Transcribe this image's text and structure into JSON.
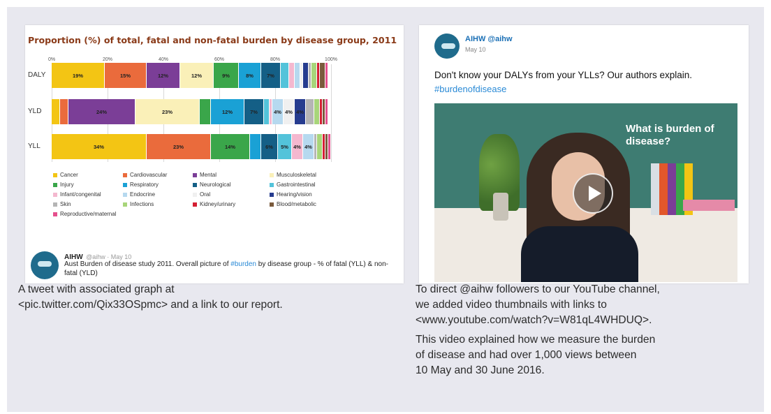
{
  "left": {
    "chart_data": {
      "type": "bar",
      "title": "Proportion (%) of total, fatal and non-fatal burden by disease group, 2011",
      "x_ticks": [
        "0%",
        "20%",
        "40%",
        "60%",
        "80%",
        "100%"
      ],
      "xlim": [
        0,
        100
      ],
      "grid": true,
      "legend_position": "bottom",
      "categories": [
        "DALY",
        "YLD",
        "YLL"
      ],
      "series": [
        {
          "name": "Cancer",
          "color": "#f3c514",
          "values": [
            19,
            3,
            34
          ],
          "labels": [
            "19%",
            "",
            "34%"
          ]
        },
        {
          "name": "Cardiovascular",
          "color": "#ea6b3c",
          "values": [
            15,
            3,
            23
          ],
          "labels": [
            "15%",
            "",
            "23%"
          ]
        },
        {
          "name": "Mental",
          "color": "#7b3e97",
          "values": [
            12,
            24,
            0
          ],
          "labels": [
            "12%",
            "24%",
            ""
          ]
        },
        {
          "name": "Musculoskeletal",
          "color": "#faf0b8",
          "values": [
            12,
            23,
            0
          ],
          "labels": [
            "12%",
            "23%",
            ""
          ]
        },
        {
          "name": "Injury",
          "color": "#3aa64a",
          "values": [
            9,
            4,
            14
          ],
          "labels": [
            "9%",
            "",
            "14%"
          ]
        },
        {
          "name": "Respiratory",
          "color": "#1aa1d5",
          "values": [
            8,
            12,
            4
          ],
          "labels": [
            "8%",
            "12%",
            ""
          ]
        },
        {
          "name": "Neurological",
          "color": "#145f86",
          "values": [
            7,
            7,
            6
          ],
          "labels": [
            "7%",
            "7%",
            "6%"
          ]
        },
        {
          "name": "Gastrointestinal",
          "color": "#53c3da",
          "values": [
            3,
            2,
            5
          ],
          "labels": [
            "",
            "",
            "5%"
          ]
        },
        {
          "name": "Infant/congenital",
          "color": "#f4b8cf",
          "values": [
            2,
            1,
            4
          ],
          "labels": [
            "",
            "",
            "4%"
          ]
        },
        {
          "name": "Endocrine",
          "color": "#b6d9ef",
          "values": [
            2,
            4,
            4
          ],
          "labels": [
            "",
            "4%",
            "4%"
          ]
        },
        {
          "name": "Oral",
          "color": "#f0f0f0",
          "values": [
            1,
            4,
            0
          ],
          "labels": [
            "",
            "4%",
            ""
          ]
        },
        {
          "name": "Hearing/vision",
          "color": "#263c8f",
          "values": [
            2,
            4,
            0
          ],
          "labels": [
            "",
            "4%",
            ""
          ]
        },
        {
          "name": "Skin",
          "color": "#b5b5b5",
          "values": [
            1,
            3,
            1
          ],
          "labels": [
            "",
            "",
            ""
          ]
        },
        {
          "name": "Infections",
          "color": "#a8d57a",
          "values": [
            2,
            2,
            2
          ],
          "labels": [
            "",
            "",
            ""
          ]
        },
        {
          "name": "Kidney/urinary",
          "color": "#d41f33",
          "values": [
            1,
            1,
            1
          ],
          "labels": [
            "",
            "",
            ""
          ]
        },
        {
          "name": "Blood/metabolic",
          "color": "#7a5a3c",
          "values": [
            2,
            1,
            1
          ],
          "labels": [
            "",
            "",
            ""
          ]
        },
        {
          "name": "Reproductive/maternal",
          "color": "#e5508d",
          "values": [
            1,
            1,
            1
          ],
          "labels": [
            "",
            "",
            ""
          ]
        }
      ]
    },
    "tweet": {
      "name": "AIHW",
      "meta": "@aihw · May 10",
      "text_before": "Aust Burden of disease study 2011. Overall picture of ",
      "hashtag": "#burden",
      "text_after": " by disease group - % of fatal (YLL) & non-fatal (YLD)"
    },
    "caption": [
      "A tweet with associated graph at",
      "<pic.twitter.com/Qix33OSpmc> and a link to our report."
    ]
  },
  "right": {
    "tweet": {
      "name": "AIHW @aihw",
      "date": "May 10",
      "text": "Don't know your DALYs from your YLLs? Our authors explain.",
      "hashtag": "#burdenofdisease",
      "video_caption": "What is burden of disease?"
    },
    "caption": [
      "To direct @aihw followers to our YouTube channel,",
      "we added video thumbnails with links to",
      "<www.youtube.com/watch?v=W81qL4WHDUQ>.",
      "This video explained how we measure the burden",
      "of disease and had over 1,000 views between",
      "10 May and 30 June 2016."
    ]
  }
}
